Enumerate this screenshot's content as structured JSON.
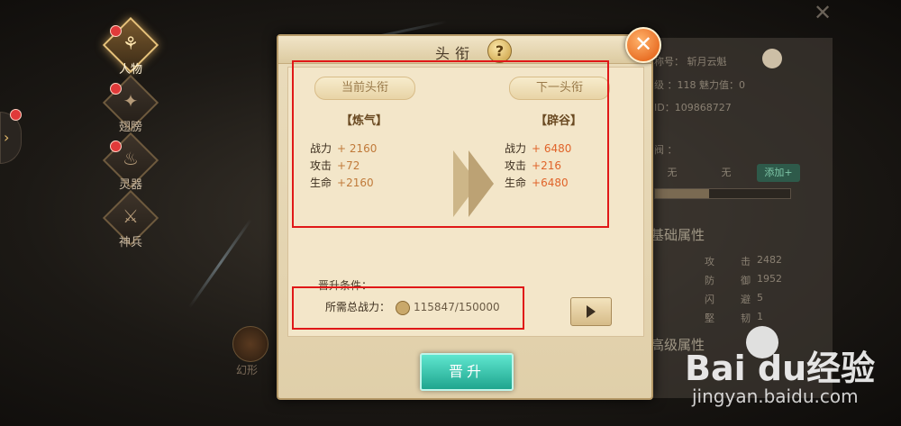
{
  "nav": {
    "items": [
      {
        "label": "人物",
        "glyph": "⚘",
        "active": true
      },
      {
        "label": "翅膀",
        "glyph": "✦"
      },
      {
        "label": "灵器",
        "glyph": "♨"
      },
      {
        "label": "神兵",
        "glyph": "⚔"
      }
    ],
    "side_arrow": "›"
  },
  "background": {
    "faded_label": "幻形",
    "close_glyph": "✕"
  },
  "info_panel": {
    "rows": [
      "称号：  斩月云魁",
      "级 ：118      魅力值：0",
      "ID：109868727",
      "阀 ："
    ],
    "segment_buttons": [
      "无",
      "无",
      "添加+"
    ],
    "base_attr_title": "基础属性",
    "adv_attr_title": "高级属性",
    "stats": [
      {
        "name": "攻",
        "key": "击",
        "value": "2482"
      },
      {
        "name": "防",
        "key": "御",
        "value": "1952"
      },
      {
        "name": "闪",
        "key": "避",
        "value": "5"
      },
      {
        "name": "堅",
        "key": "韧",
        "value": "1"
      }
    ]
  },
  "dialog": {
    "title": "头衔",
    "help": "?",
    "close": "✕",
    "current": {
      "banner": "当前头衔",
      "rank": "【炼气】",
      "stats": [
        {
          "name": "战力",
          "value": "+ 2160"
        },
        {
          "name": "攻击",
          "value": "+72"
        },
        {
          "name": "生命",
          "value": "+2160"
        }
      ]
    },
    "next": {
      "banner": "下一头衔",
      "rank": "【辟谷】",
      "stats": [
        {
          "name": "战力",
          "value": "+ 6480"
        },
        {
          "name": "攻击",
          "value": "+216"
        },
        {
          "name": "生命",
          "value": "+6480"
        }
      ]
    },
    "condition_label": "晋升条件：",
    "required_power_label": "所需总战力：",
    "required_power_value": "115847/150000",
    "promote_button": "晋升"
  },
  "watermark": {
    "logo": "Bai  du经验",
    "url": "jingyan.baidu.com"
  },
  "colors": {
    "highlight_box": "#e01818",
    "promote_button": "#1fa58e",
    "close_button": "#e0560c"
  }
}
